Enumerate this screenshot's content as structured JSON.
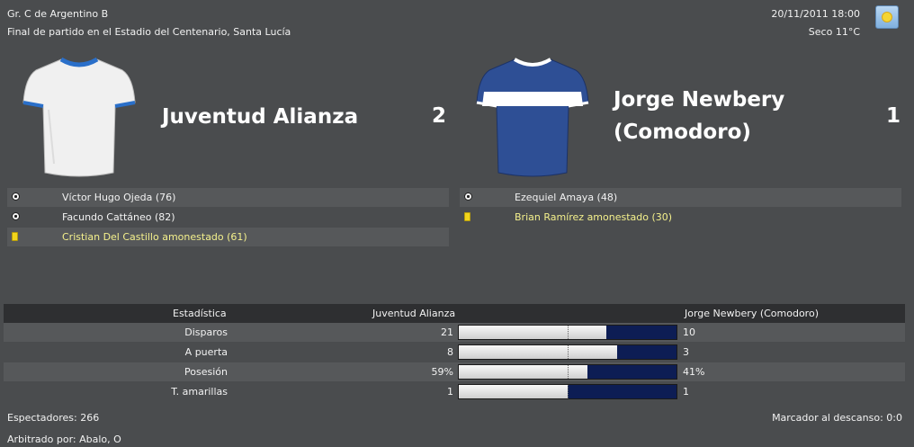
{
  "header": {
    "competition": "Gr. C de Argentino B",
    "match_info": "Final de partido en el Estadio del Centenario, Santa Lucía",
    "datetime": "20/11/2011 18:00",
    "weather_text": "Seco 11°C",
    "weather_icon": "sun-icon"
  },
  "home": {
    "name": "Juventud Alianza",
    "score": "2",
    "shirt_colors": {
      "body": "#f0f0f0",
      "trim": "#2a6fc9"
    },
    "events": [
      {
        "type": "goal",
        "icon": "ball-icon",
        "text": "Víctor Hugo Ojeda (76)"
      },
      {
        "type": "goal",
        "icon": "ball-icon",
        "text": "Facundo Cattáneo (82)"
      },
      {
        "type": "yellow",
        "icon": "yellow-card-icon",
        "text": "Cristian Del Castillo amonestado (61)"
      }
    ]
  },
  "away": {
    "name_line1": "Jorge Newbery",
    "name_line2": "(Comodoro)",
    "score": "1",
    "shirt_colors": {
      "body": "#2e4f95",
      "band": "#ffffff"
    },
    "events": [
      {
        "type": "goal",
        "icon": "ball-icon",
        "text": "Ezequiel Amaya (48)"
      },
      {
        "type": "yellow",
        "icon": "yellow-card-icon",
        "text": "Brian Ramírez amonestado (30)"
      }
    ]
  },
  "stats": {
    "header": {
      "label": "Estadística",
      "home": "Juventud Alianza",
      "away": "Jorge Newbery (Comodoro)"
    },
    "rows": [
      {
        "label": "Disparos",
        "home": "21",
        "away": "10",
        "home_share": 0.677
      },
      {
        "label": "A puerta",
        "home": "8",
        "away": "3",
        "home_share": 0.727
      },
      {
        "label": "Posesión",
        "home": "59%",
        "away": "41%",
        "home_share": 0.59
      },
      {
        "label": "T. amarillas",
        "home": "1",
        "away": "1",
        "home_share": 0.5
      }
    ],
    "colors": {
      "home_bar": "#e6e6e6",
      "away_bar": "#0d1d54"
    }
  },
  "footer": {
    "attendance": "Espectadores: 266",
    "halftime": "Marcador al descanso: 0:0",
    "referee": "Arbitrado por: Abalo, O"
  }
}
